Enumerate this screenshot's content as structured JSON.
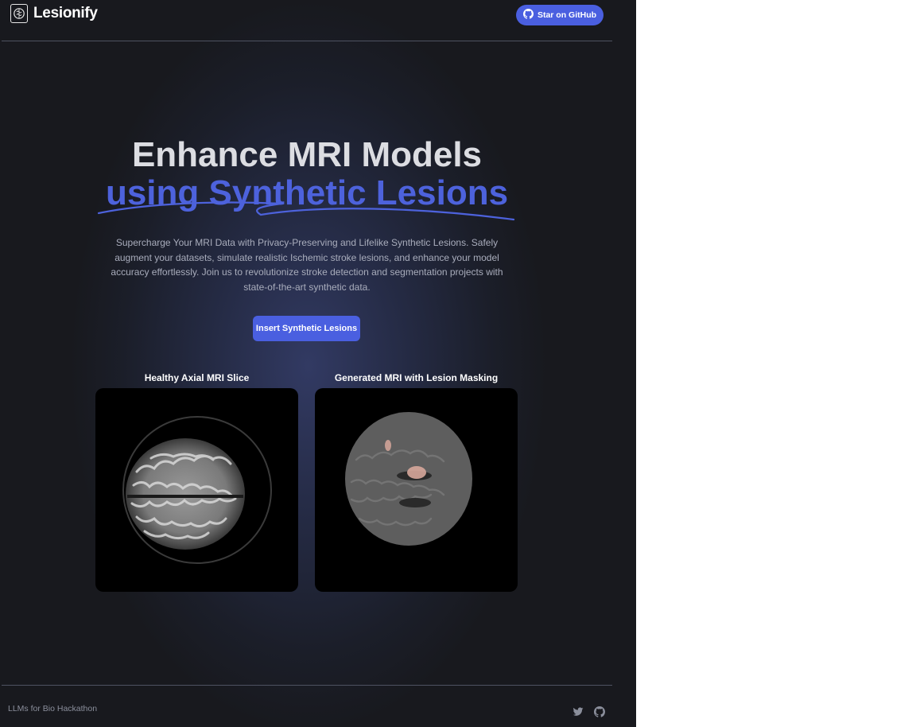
{
  "brand": {
    "name": "Lesionify",
    "logo_icon": "brain-icon"
  },
  "header": {
    "github_button": {
      "label": "Star on GitHub",
      "icon": "github-icon"
    }
  },
  "hero": {
    "title_line1": "Enhance MRI Models",
    "title_line2": "using Synthetic Lesions",
    "description": "Supercharge Your MRI Data with Privacy-Preserving and Lifelike Synthetic Lesions. Safely augment your datasets, simulate realistic Ischemic stroke lesions, and enhance your model accuracy effortlessly. Join us to revolutionize stroke detection and segmentation projects with state-of-the-art synthetic data.",
    "cta_label": "Insert Synthetic Lesions"
  },
  "panels": [
    {
      "label": "Healthy Axial MRI Slice"
    },
    {
      "label": "Generated MRI with Lesion Masking"
    }
  ],
  "footer": {
    "text": "LLMs for Bio Hackathon",
    "icons": [
      "twitter-icon",
      "github-icon"
    ]
  },
  "colors": {
    "accent": "#4a5fe0",
    "title": "#dcdde2",
    "title_accent": "#4d62dc",
    "background": "#1b1e29"
  }
}
